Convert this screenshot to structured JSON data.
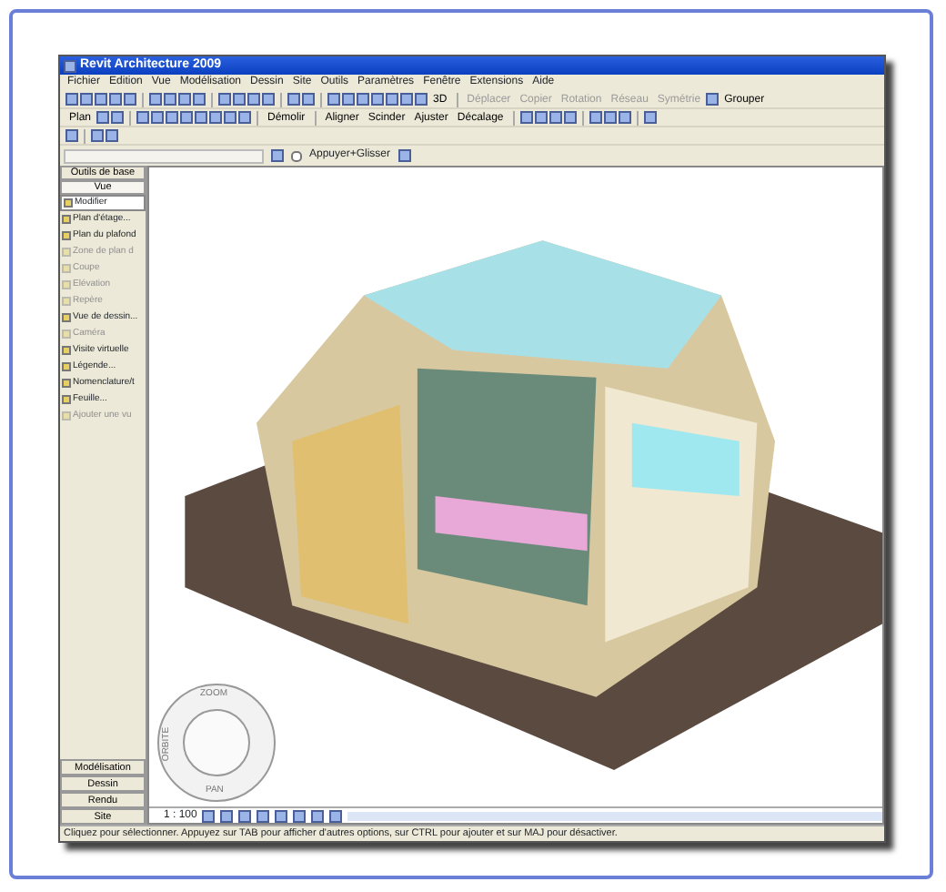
{
  "window": {
    "title": "Revit Architecture 2009"
  },
  "menu": [
    "Fichier",
    "Edition",
    "Vue",
    "Modélisation",
    "Dessin",
    "Site",
    "Outils",
    "Paramètres",
    "Fenêtre",
    "Extensions",
    "Aide"
  ],
  "toolbars": [
    [
      {
        "kind": "icon"
      },
      {
        "kind": "icon"
      },
      {
        "kind": "icon"
      },
      {
        "kind": "icon"
      },
      {
        "kind": "icon"
      },
      {
        "kind": "sep"
      },
      {
        "kind": "icon"
      },
      {
        "kind": "icon"
      },
      {
        "kind": "icon"
      },
      {
        "kind": "icon"
      },
      {
        "kind": "sep"
      },
      {
        "kind": "icon"
      },
      {
        "kind": "icon"
      },
      {
        "kind": "icon"
      },
      {
        "kind": "icon"
      },
      {
        "kind": "sep"
      },
      {
        "kind": "icon"
      },
      {
        "kind": "icon"
      },
      {
        "kind": "sep"
      },
      {
        "kind": "icon"
      },
      {
        "kind": "icon"
      },
      {
        "kind": "icon"
      },
      {
        "kind": "icon"
      },
      {
        "kind": "icon"
      },
      {
        "kind": "icon"
      },
      {
        "kind": "icon"
      },
      {
        "kind": "button",
        "label": "3D",
        "disabled": false
      },
      {
        "kind": "sep"
      },
      {
        "kind": "button",
        "label": "Déplacer",
        "disabled": true
      },
      {
        "kind": "button",
        "label": "Copier",
        "disabled": true
      },
      {
        "kind": "button",
        "label": "Rotation",
        "disabled": true
      },
      {
        "kind": "button",
        "label": "Réseau",
        "disabled": true
      },
      {
        "kind": "button",
        "label": "Symétrie",
        "disabled": true
      },
      {
        "kind": "icon"
      },
      {
        "kind": "button",
        "label": "Grouper",
        "disabled": false
      }
    ],
    [
      {
        "kind": "button",
        "label": "Plan",
        "disabled": false
      },
      {
        "kind": "icon"
      },
      {
        "kind": "icon"
      },
      {
        "kind": "sep"
      },
      {
        "kind": "icon"
      },
      {
        "kind": "icon"
      },
      {
        "kind": "icon"
      },
      {
        "kind": "icon"
      },
      {
        "kind": "icon"
      },
      {
        "kind": "icon"
      },
      {
        "kind": "icon"
      },
      {
        "kind": "icon"
      },
      {
        "kind": "sep"
      },
      {
        "kind": "button",
        "label": "Démolir",
        "disabled": false
      },
      {
        "kind": "sep"
      },
      {
        "kind": "button",
        "label": "Aligner",
        "disabled": false
      },
      {
        "kind": "button",
        "label": "Scinder",
        "disabled": false
      },
      {
        "kind": "button",
        "label": "Ajuster",
        "disabled": false
      },
      {
        "kind": "button",
        "label": "Décalage",
        "disabled": false
      },
      {
        "kind": "sep"
      },
      {
        "kind": "icon"
      },
      {
        "kind": "icon"
      },
      {
        "kind": "icon"
      },
      {
        "kind": "icon"
      },
      {
        "kind": "sep"
      },
      {
        "kind": "icon"
      },
      {
        "kind": "icon"
      },
      {
        "kind": "icon"
      },
      {
        "kind": "sep"
      },
      {
        "kind": "icon"
      }
    ],
    [
      {
        "kind": "icon"
      },
      {
        "kind": "sep"
      },
      {
        "kind": "icon"
      },
      {
        "kind": "icon"
      }
    ]
  ],
  "options_bar": {
    "snap_drag": {
      "label": "Appuyer+Glisser",
      "checked": false
    }
  },
  "sidebar": {
    "headers": [
      {
        "label": "Outils de base",
        "selected": false
      },
      {
        "label": "Vue",
        "selected": true
      }
    ],
    "items": [
      {
        "label": "Modifier",
        "selected": true,
        "disabled": false
      },
      {
        "label": "Plan d'étage...",
        "selected": false,
        "disabled": false
      },
      {
        "label": "Plan du plafond",
        "selected": false,
        "disabled": false
      },
      {
        "label": "Zone de plan d",
        "selected": false,
        "disabled": true
      },
      {
        "label": "Coupe",
        "selected": false,
        "disabled": true
      },
      {
        "label": "Elévation",
        "selected": false,
        "disabled": true
      },
      {
        "label": "Repère",
        "selected": false,
        "disabled": true
      },
      {
        "label": "Vue de dessin...",
        "selected": false,
        "disabled": false
      },
      {
        "label": "Caméra",
        "selected": false,
        "disabled": true
      },
      {
        "label": "Visite virtuelle",
        "selected": false,
        "disabled": false
      },
      {
        "label": "Légende...",
        "selected": false,
        "disabled": false
      },
      {
        "label": "Nomenclature/t",
        "selected": false,
        "disabled": false
      },
      {
        "label": "Feuille...",
        "selected": false,
        "disabled": false
      },
      {
        "label": "Ajouter une vu",
        "selected": false,
        "disabled": true
      }
    ],
    "tabs": [
      "Modélisation",
      "Dessin",
      "Rendu",
      "Site"
    ]
  },
  "wheel": {
    "top": "ZOOM",
    "left": "ORBITE",
    "bottom": "PAN"
  },
  "view_bar": {
    "scale": "1 : 100"
  },
  "status_bar": "Cliquez pour sélectionner. Appuyez sur TAB pour afficher d'autres options, sur CTRL pour ajouter et sur MAJ pour désactiver."
}
